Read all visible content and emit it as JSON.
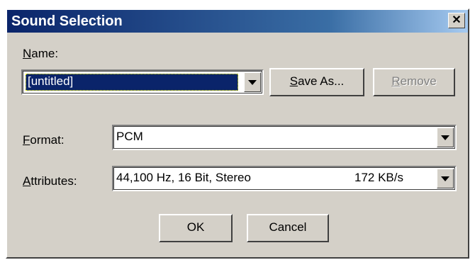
{
  "window": {
    "title": "Sound Selection",
    "close_glyph": "✕"
  },
  "name": {
    "label_first": "N",
    "label_rest": "ame:",
    "value": "[untitled]"
  },
  "buttons": {
    "save_as_first": "S",
    "save_as_rest": "ave As...",
    "remove_first": "R",
    "remove_rest": "emove",
    "ok": "OK",
    "cancel": "Cancel"
  },
  "format": {
    "label_first": "F",
    "label_rest": "ormat:",
    "value": "PCM"
  },
  "attributes": {
    "label_first": "A",
    "label_rest": "ttributes:",
    "value": "44,100 Hz, 16 Bit, Stereo",
    "rate": "172 KB/s"
  },
  "colors": {
    "title_bar": "#0a246a",
    "dialog_face": "#d4d0c8"
  },
  "icons": [
    "close-icon",
    "chevron-down-icon"
  ]
}
